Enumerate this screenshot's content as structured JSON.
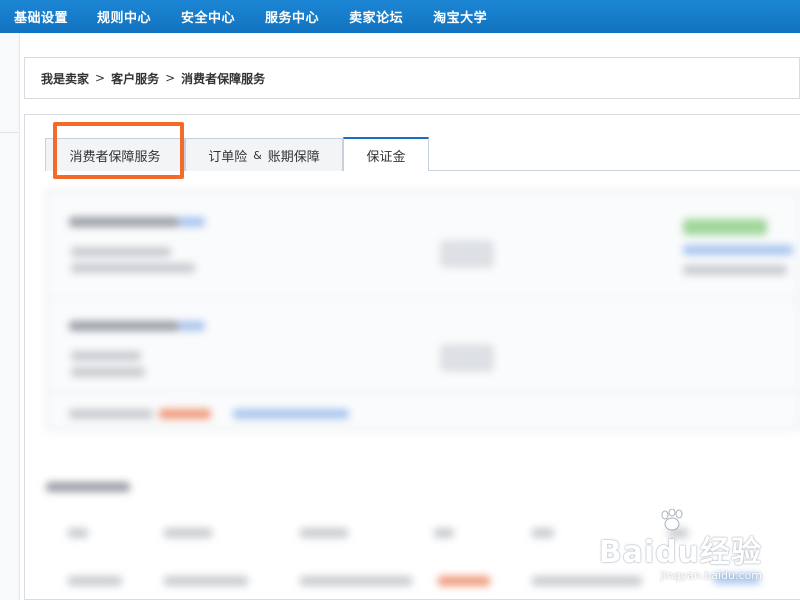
{
  "topnav": {
    "items": [
      "基础设置",
      "规则中心",
      "安全中心",
      "服务中心",
      "卖家论坛",
      "淘宝大学"
    ]
  },
  "breadcrumb": {
    "items": [
      "我是卖家",
      "客户服务",
      "消费者保障服务"
    ],
    "separator": ">"
  },
  "tabs": {
    "tab1": "消费者保障服务",
    "tab2_a": "订单险",
    "tab2_amp": "&",
    "tab2_b": "账期保障",
    "tab3": "保证金",
    "active": "保证金"
  },
  "colors": {
    "nav_bg": "#1273c0",
    "highlight": "#f26b2a",
    "active_tab_border": "#1a6fc4"
  },
  "watermark": {
    "main": "Baidu经验",
    "sub": "jingyan.baidu.com"
  }
}
